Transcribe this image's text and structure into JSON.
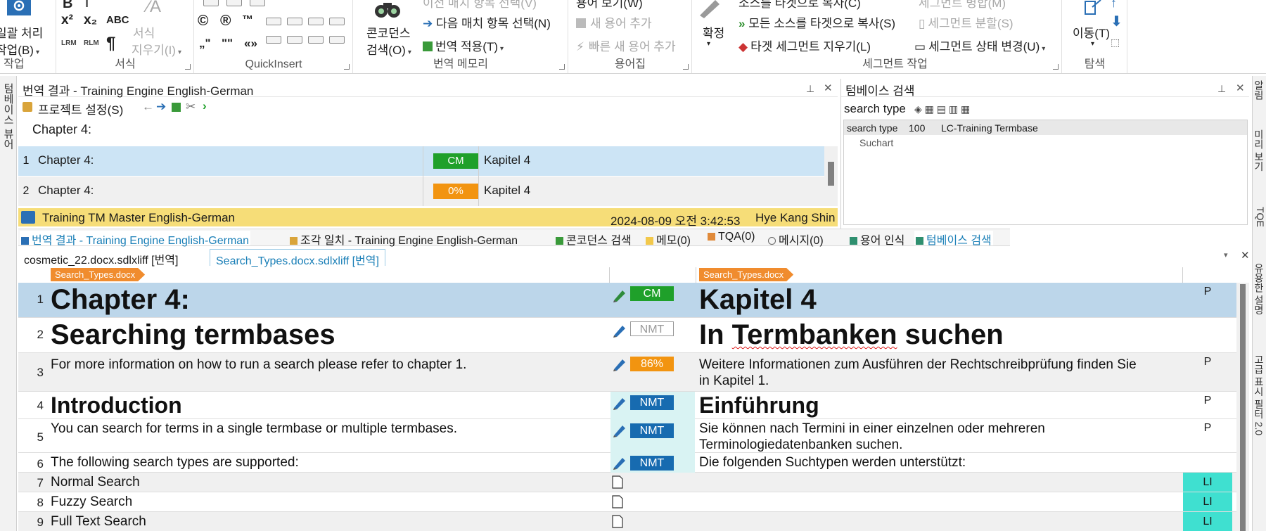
{
  "ribbon": {
    "file_work": {
      "big_icon": "gear-icon",
      "line1": "일괄 처리",
      "line2": "작업(B)",
      "group": "일 작업"
    },
    "format": {
      "group": "서식",
      "clear_line1": "서식",
      "clear_line2": "지우기(I)",
      "glyphs": [
        "B",
        "x²",
        "x₂",
        "ABC",
        "¶"
      ]
    },
    "quickinsert": {
      "group": "QuickInsert",
      "row1": [
        "©",
        "®",
        "™"
      ],
      "row3": [
        "„\"",
        "\"\"",
        "«»"
      ]
    },
    "concordance": {
      "line1": "콘코던스",
      "line2": "검색(O)"
    },
    "tm": {
      "group": "번역 메모리",
      "item_top": "이전 매치 항목 선택(V)",
      "item_next": "다음 매치 항목 선택(N)",
      "item_apply": "번역 적용(T)"
    },
    "terms": {
      "group": "용어집",
      "item_top": "용어 보기(W)",
      "item_add": "새 용어 추가",
      "item_quick": "빠른 새 용어 추가"
    },
    "confirm": {
      "label": "확정"
    },
    "segment": {
      "group": "세그먼트 작업",
      "item_top_left": "소스를 타겟으로 복사(C)",
      "item_top_right": "세그먼트 병합(M)",
      "copy_all": "모든 소스를 타겟으로 복사(S)",
      "split": "세그먼트 분할(S)",
      "clear": "타겟 세그먼트 지우기(L)",
      "status": "세그먼트 상태 변경(U)"
    },
    "nav": {
      "group": "탐색",
      "move": "이동(T)"
    }
  },
  "left_strip": {
    "tab": "텀베이스 뷰어"
  },
  "right_strip": {
    "tabs": [
      "알림",
      "미리 보기",
      "TQE",
      "유용한 설명",
      "고급 표시 필터 2.0"
    ]
  },
  "translation_results": {
    "title": "번역 결과 - Training Engine English-German",
    "toolbar_label": "프로젝트 설정(S)",
    "source_preview": "Chapter 4:",
    "rows": [
      {
        "num": "1",
        "source": "Chapter 4:",
        "badge": "CM",
        "badge_color": "#1fa02a",
        "target": "Kapitel 4"
      },
      {
        "num": "2",
        "source": "Chapter 4:",
        "badge": "0%",
        "badge_color": "#f29410",
        "target": "Kapitel 4"
      }
    ],
    "footer": {
      "tm_name": "Training TM Master English-German",
      "timestamp": "2024-08-09 오전 3:42:53",
      "user": "Hye Kang Shin"
    }
  },
  "termbase_search": {
    "title": "텀베이스 검색",
    "input_value": "search type",
    "result_term": "search type",
    "result_score": "100",
    "result_tb": "LC-Training Termbase",
    "result_translation": "Suchart"
  },
  "window_tabs": [
    {
      "label": "번역 결과 - Training Engine English-German",
      "active": true
    },
    {
      "label": "조각 일치 - Training Engine English-German",
      "active": false
    },
    {
      "label": "콘코던스 검색",
      "active": false
    },
    {
      "label": "메모(0)",
      "active": false
    },
    {
      "label": "TQA(0)",
      "active": false
    },
    {
      "label": "메시지(0)",
      "active": false
    },
    {
      "label": "용어 인식",
      "active": false
    },
    {
      "label": "텀베이스 검색",
      "active": true
    }
  ],
  "doc_tabs": [
    {
      "label": "cosmetic_22.docx.sdlxliff [번역]",
      "active": false
    },
    {
      "label": "Search_Types.docx.sdlxliff [번역]",
      "active": true
    }
  ],
  "editor": {
    "source_file_tag": "Search_Types.docx",
    "target_file_tag": "Search_Types.docx",
    "rows": [
      {
        "num": "1",
        "source": "Chapter 4:",
        "status": "CM",
        "target": "Kapitel 4",
        "col": "P"
      },
      {
        "num": "2",
        "source": "Searching termbases",
        "status": "NMT",
        "target": "In Termbanken suchen",
        "col": ""
      },
      {
        "num": "3",
        "source": "For more information on how to run a search please refer to chapter 1.",
        "status": "86%",
        "target_line1": "Weitere Informationen zum Ausführen der Rechtschreibprüfung finden Sie",
        "target_line2": "in Kapitel 1.",
        "col": "P"
      },
      {
        "num": "4",
        "source": "Introduction",
        "status": "NMT",
        "target": "Einführung",
        "col": "P"
      },
      {
        "num": "5",
        "source": "You can search for terms in a single termbase or multiple termbases.",
        "status": "NMT",
        "target_line1": "Sie können nach Termini in einer einzelnen oder mehreren",
        "target_line2": "Terminologiedatenbanken suchen.",
        "col": "P"
      },
      {
        "num": "6",
        "source": "The following search types are supported:",
        "status": "NMT",
        "target": "Die folgenden Suchtypen werden unterstützt:",
        "col": ""
      },
      {
        "num": "7",
        "source": "Normal Search",
        "status": "",
        "target": "",
        "col": "LI"
      },
      {
        "num": "8",
        "source": "Fuzzy Search",
        "status": "",
        "target": "",
        "col": "LI"
      },
      {
        "num": "9",
        "source": "Full Text Search",
        "status": "",
        "target": "",
        "col": "LI"
      }
    ]
  },
  "colors": {
    "selection_blue": "#bcd6ea",
    "cm_green": "#1fa02a",
    "nmt_blue": "#176bb0",
    "fuzzy_orange": "#f29410",
    "li_teal": "#3fe0d0",
    "file_tag_orange": "#f08c2e",
    "tm_footer_yellow": "#f6dd78"
  }
}
